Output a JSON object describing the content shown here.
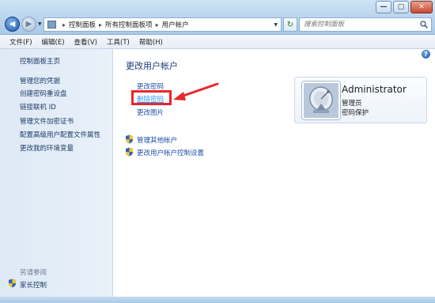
{
  "window": {
    "minimize_glyph": "—",
    "maximize_glyph": "▢",
    "close_glyph": "✕"
  },
  "navigation": {
    "back_glyph": "◀",
    "forward_glyph": "▶",
    "dropdown_glyph": "▼"
  },
  "address_bar": {
    "crumbs": [
      "控制面板",
      "所有控制面板项",
      "用户帐户"
    ],
    "separator": "▸",
    "dropdown_glyph": "▼",
    "refresh_glyph": "↻"
  },
  "search": {
    "placeholder": "搜索控制面板"
  },
  "menu": {
    "items": [
      "文件(F)",
      "编辑(E)",
      "查看(V)",
      "工具(T)",
      "帮助(H)"
    ]
  },
  "sidebar": {
    "items": [
      "控制面板主页",
      "管理您的凭据",
      "创建密码重设盘",
      "链接联机 ID",
      "管理文件加密证书",
      "配置高级用户配置文件属性",
      "更改我的环境变量"
    ],
    "see_also_label": "另请参阅",
    "parental_controls_label": "家长控制"
  },
  "main": {
    "help_glyph": "?",
    "title": "更改用户帐户",
    "tasks": [
      "更改密码",
      "删除密码",
      "更改图片"
    ],
    "other_tasks": [
      "管理其他帐户",
      "更改用户帐户控制设置"
    ]
  },
  "user": {
    "name": "Administrator",
    "role": "管理员",
    "password_status": "密码保护"
  },
  "colors": {
    "link": "#1e4fa8",
    "active_link": "#3399ff",
    "highlight": "#e8272b",
    "title": "#1a3a7a"
  }
}
